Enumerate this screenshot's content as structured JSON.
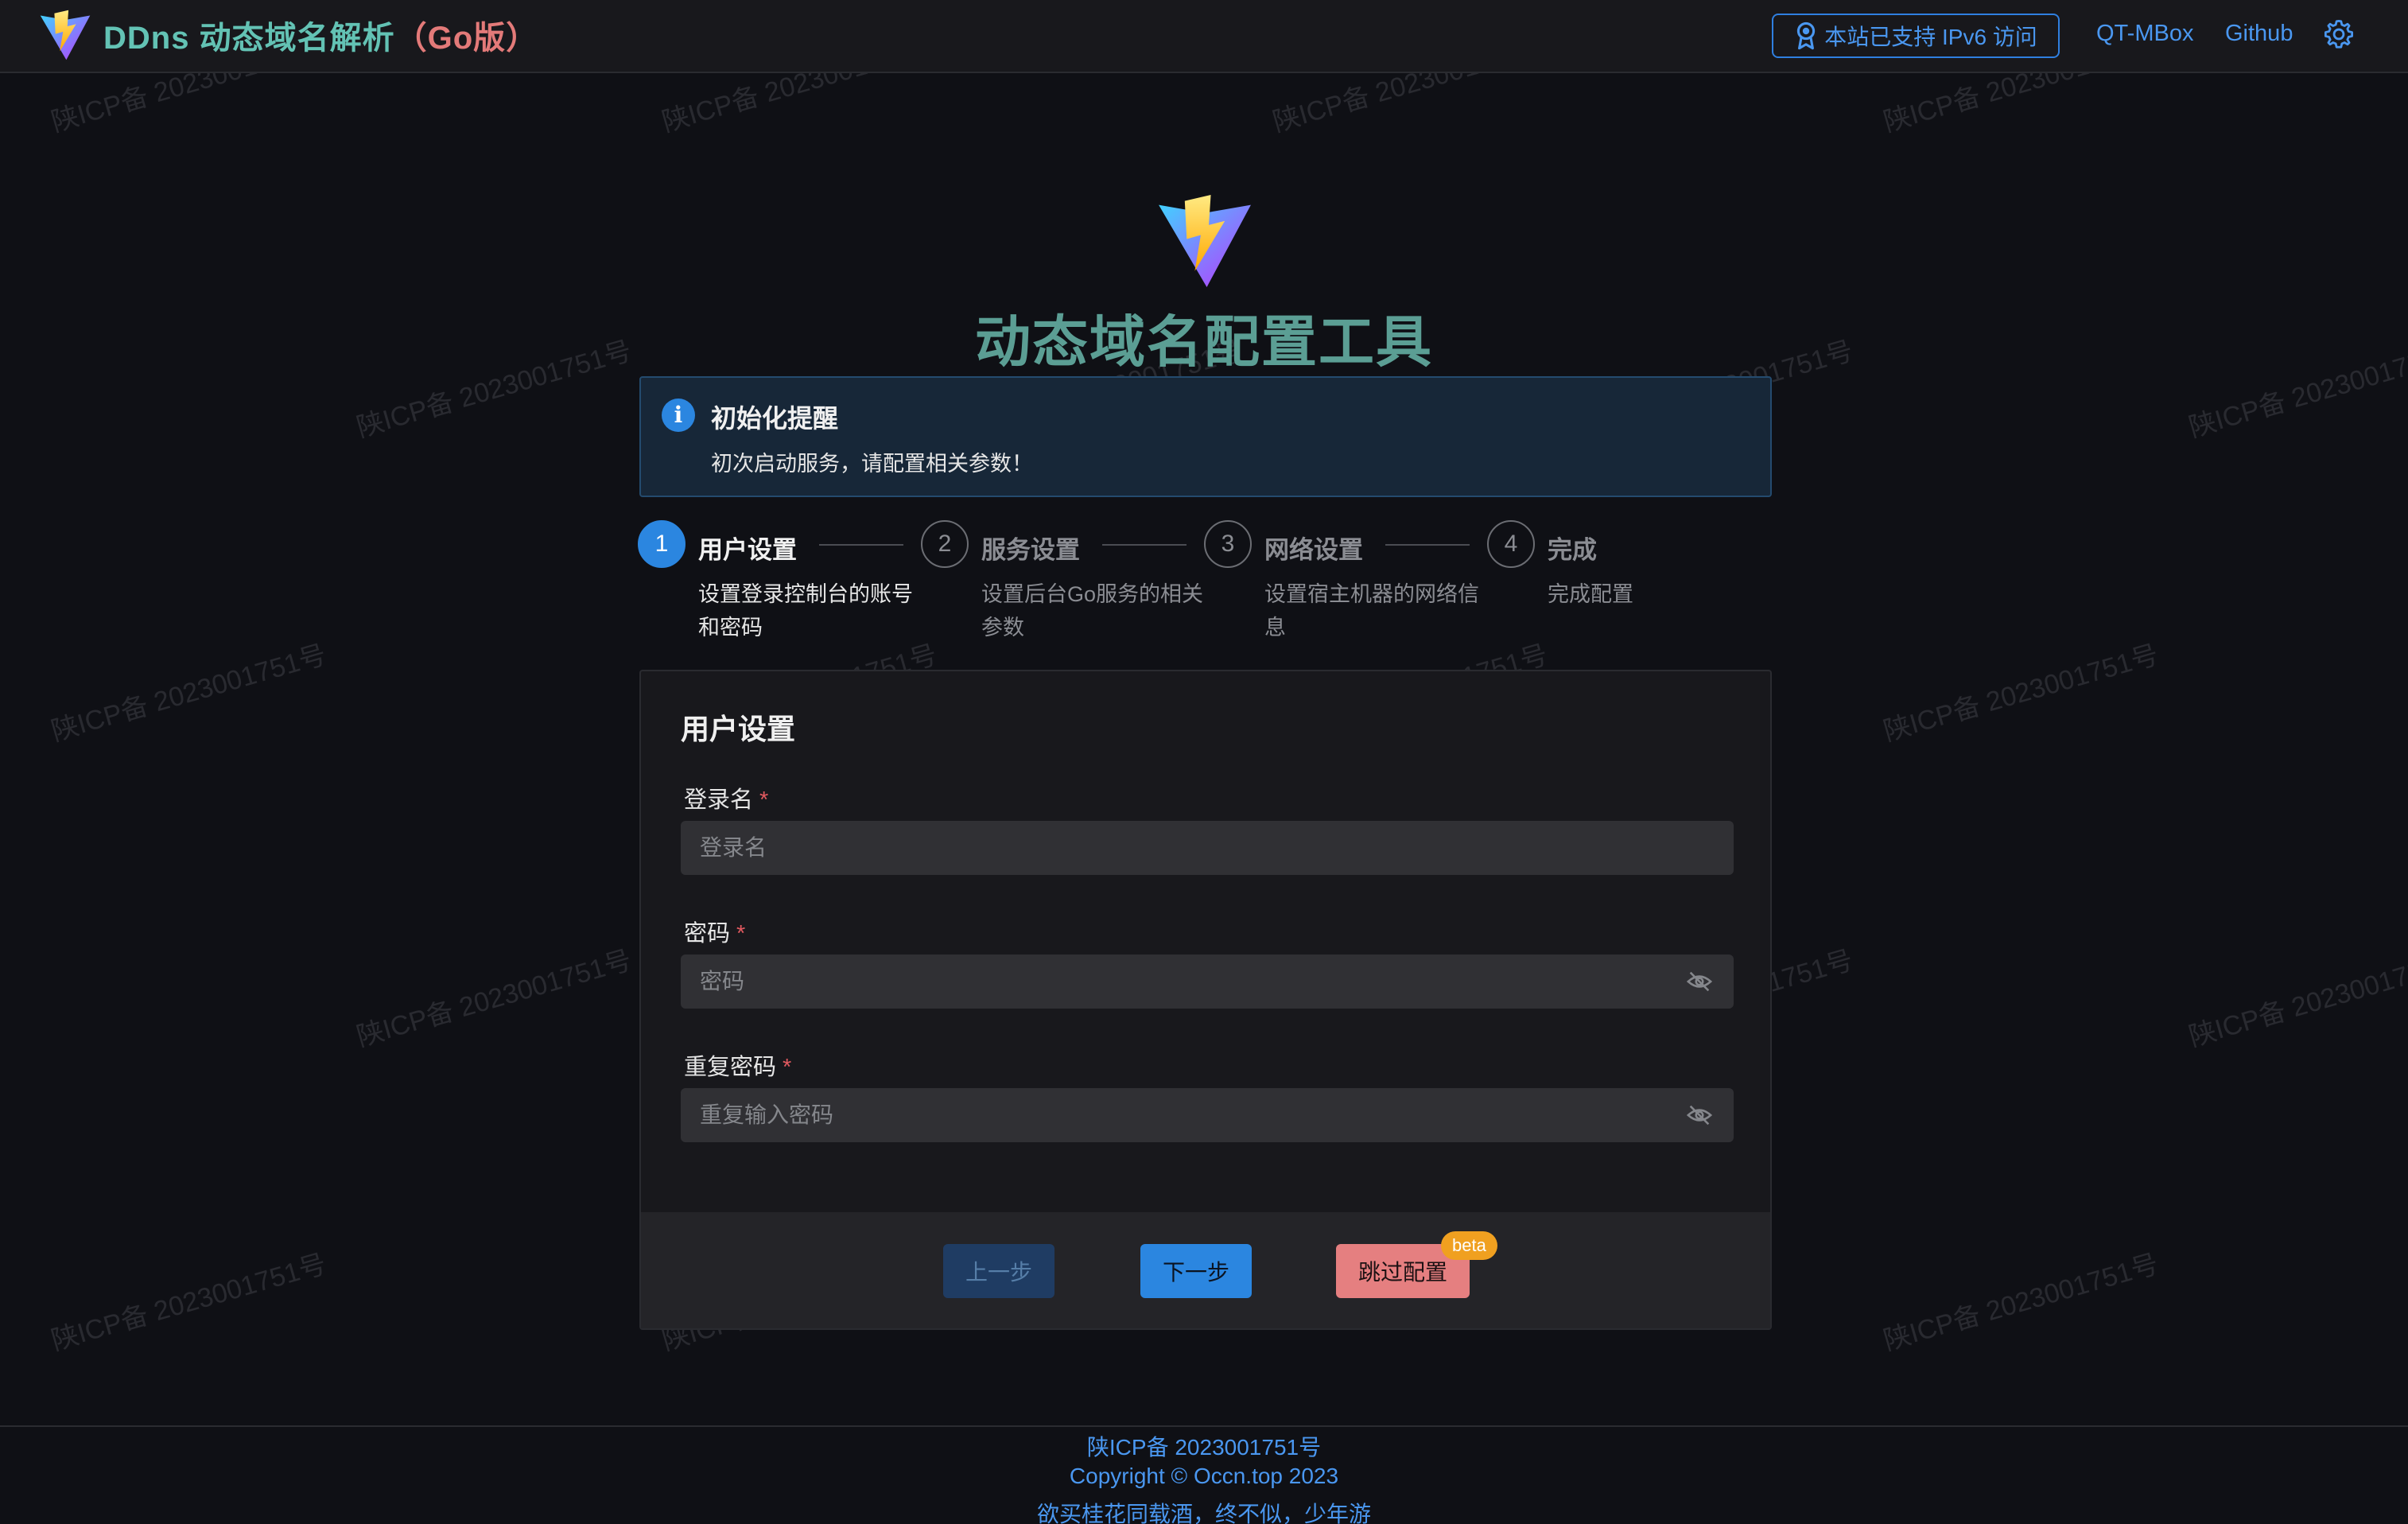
{
  "header": {
    "brand_main": "DDns 动态域名解析",
    "brand_go": "（Go版）",
    "ipv6_badge": "本站已支持 IPv6 访问",
    "links": [
      "QT-MBox",
      "Github"
    ]
  },
  "watermark": "陕ICP备 2023001751号",
  "hero": {
    "title": "动态域名配置工具"
  },
  "alert": {
    "icon": "i",
    "title": "初始化提醒",
    "text": "初次启动服务，请配置相关参数！"
  },
  "steps": [
    {
      "number": "1",
      "title": "用户设置",
      "desc": "设置登录控制台的账号和密码",
      "active": true
    },
    {
      "number": "2",
      "title": "服务设置",
      "desc": "设置后台Go服务的相关参数",
      "active": false
    },
    {
      "number": "3",
      "title": "网络设置",
      "desc": "设置宿主机器的网络信息",
      "active": false
    },
    {
      "number": "4",
      "title": "完成",
      "desc": "完成配置",
      "active": false
    }
  ],
  "form": {
    "title": "用户设置",
    "fields": [
      {
        "label": "登录名",
        "required_mark": "*",
        "placeholder": "登录名",
        "value": ""
      },
      {
        "label": "密码",
        "required_mark": "*",
        "placeholder": "密码",
        "value": ""
      },
      {
        "label": "重复密码",
        "required_mark": "*",
        "placeholder": "重复输入密码",
        "value": ""
      }
    ],
    "buttons": {
      "prev": "上一步",
      "next": "下一步",
      "skip": "跳过配置",
      "beta_badge": "beta"
    }
  },
  "footer": {
    "icp": "陕ICP备 2023001751号",
    "copyright": "Copyright © Occn.top 2023",
    "poem": "欲买桂花同载酒，终不似，少年游"
  },
  "colors": {
    "accent": "#2b86e0",
    "brand_teal": "#63c2b4",
    "brand_red": "#e37a79",
    "title_teal": "#5b9e94",
    "skip_button": "#e57f80",
    "beta_badge": "#f0a020",
    "background": "#0f1015"
  }
}
